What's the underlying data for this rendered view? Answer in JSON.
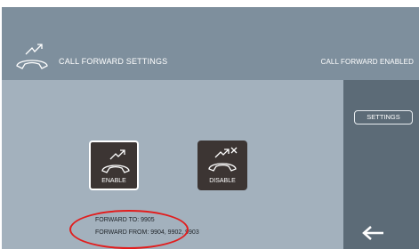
{
  "header": {
    "title": "CALL FORWARD SETTINGS",
    "status": "CALL FORWARD ENABLED"
  },
  "sidebar": {
    "settings_label": "SETTINGS",
    "back_icon": "back-arrow-icon"
  },
  "controls": {
    "enable_label": "ENABLE",
    "disable_label": "DISABLE",
    "enable_icon": "call-forward-icon",
    "disable_icon": "call-forward-off-icon"
  },
  "info": {
    "forward_to": "FORWARD TO:  9905",
    "forward_from": "FORWARD FROM:  9904, 9902, 9903"
  },
  "colors": {
    "header_bg": "#7e8f9d",
    "body_bg": "#a3b1bd",
    "sidebar_bg": "#5c6b77",
    "button_bg": "#3c3533",
    "annotation_circle": "#e21d1d"
  }
}
